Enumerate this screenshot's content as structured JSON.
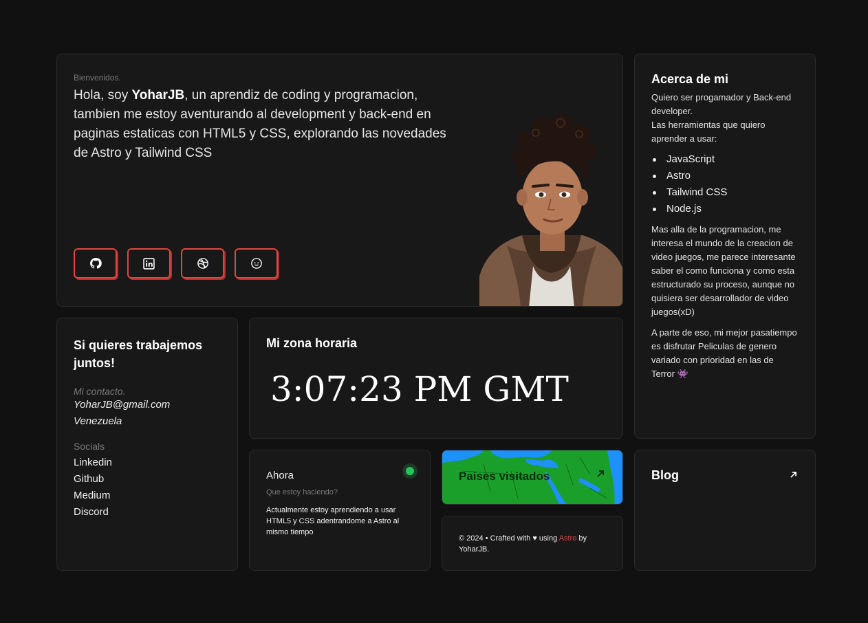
{
  "hero": {
    "eyebrow": "Bienvenidos.",
    "intro_prefix": "Hola, soy ",
    "name": "YoharJB",
    "intro_rest": ", un aprendiz de coding y programacion, tambien me estoy aventurando al development y back-end en paginas estaticas con HTML5 y CSS, explorando las novedades de Astro y Tailwind CSS",
    "socials": [
      {
        "icon": "github-icon"
      },
      {
        "icon": "linkedin-icon"
      },
      {
        "icon": "dribbble-icon"
      },
      {
        "icon": "reddit-icon"
      }
    ]
  },
  "about": {
    "title": "Acerca de mi",
    "intro": "Quiero ser progamador y Back-end developer.",
    "tools_label": "Las herramientas que quiero aprender a usar:",
    "tools": [
      "JavaScript",
      "Astro",
      "Tailwind CSS",
      "Node.js"
    ],
    "para1": "Mas alla de la programacion, me interesa el mundo de la creacion de video juegos, me parece interesante saber el como funciona y como esta estructurado su proceso, aunque no quisiera ser desarrollador de video juegos(xD)",
    "para2": "A parte de eso, mi mejor pasatiempo es disfrutar Peliculas de genero variado con prioridad en las de Terror",
    "para2_emoji": "👾"
  },
  "contact": {
    "title": "Si quieres trabajemos juntos!",
    "contact_label": "Mi contacto.",
    "email": "YoharJB@gmail.com",
    "country": "Venezuela",
    "socials_label": "Socials",
    "socials": [
      "Linkedin",
      "Github",
      "Medium",
      "Discord"
    ]
  },
  "timezone": {
    "title": "Mi zona horaria",
    "time": "3:07:23 PM GMT"
  },
  "now": {
    "title": "Ahora",
    "subtitle": "Que estoy haciendo?",
    "body": "Actualmente estoy aprendiendo a usar HTML5 y CSS adentrandome a Astro al mismo tiempo",
    "status_color": "#22c55e"
  },
  "countries": {
    "label": "Paises visitados"
  },
  "footer": {
    "prefix": "© 2024 • Crafted with ♥ using ",
    "link": "Astro",
    "suffix": " by YoharJB."
  },
  "blog": {
    "title": "Blog"
  },
  "colors": {
    "accent": "#e04545",
    "background": "#111111",
    "card": "#181818",
    "map_land": "#1a9f2b",
    "map_water": "#1e90ff"
  }
}
